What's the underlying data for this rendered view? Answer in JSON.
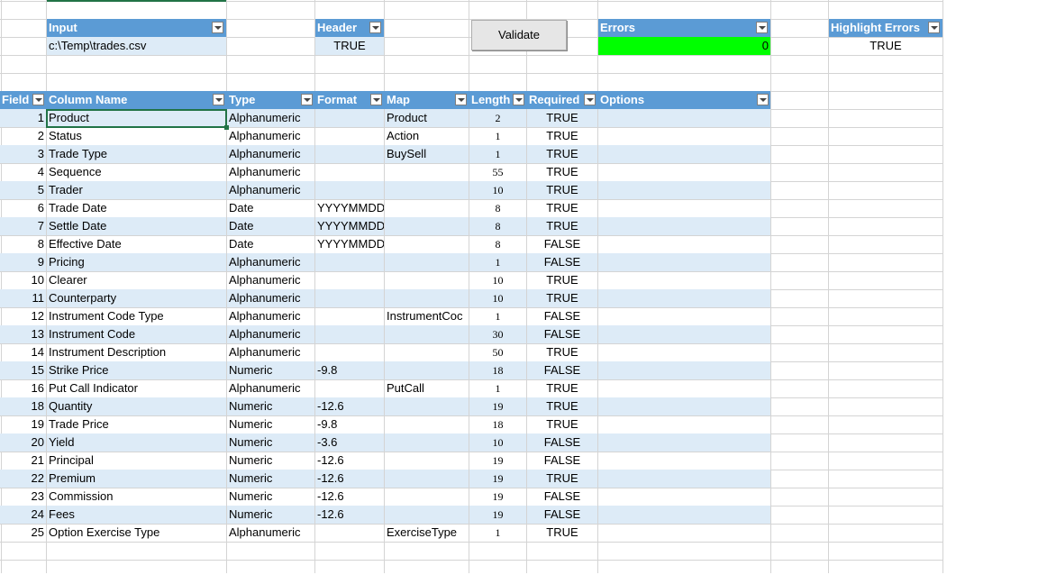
{
  "params": {
    "input": {
      "header": "Input",
      "value": "c:\\Temp\\trades.csv"
    },
    "header": {
      "header": "Header",
      "value": "TRUE"
    },
    "validate_label": "Validate",
    "errors": {
      "header": "Errors",
      "value": "0",
      "status_color": "#00ff00"
    },
    "highlight_errors": {
      "header": "Highlight Errors",
      "value": "TRUE"
    }
  },
  "table": {
    "columns": [
      "Field",
      "Column Name",
      "Type",
      "Format",
      "Map",
      "Length",
      "Required",
      "Options"
    ],
    "rows": [
      {
        "field": "1",
        "name": "Product",
        "type": "Alphanumeric",
        "format": "",
        "map": "Product",
        "length": "2",
        "required": "TRUE",
        "options": ""
      },
      {
        "field": "2",
        "name": "Status",
        "type": "Alphanumeric",
        "format": "",
        "map": "Action",
        "length": "1",
        "required": "TRUE",
        "options": ""
      },
      {
        "field": "3",
        "name": "Trade Type",
        "type": "Alphanumeric",
        "format": "",
        "map": "BuySell",
        "length": "1",
        "required": "TRUE",
        "options": ""
      },
      {
        "field": "4",
        "name": "Sequence",
        "type": "Alphanumeric",
        "format": "",
        "map": "",
        "length": "55",
        "required": "TRUE",
        "options": ""
      },
      {
        "field": "5",
        "name": "Trader",
        "type": "Alphanumeric",
        "format": "",
        "map": "",
        "length": "10",
        "required": "TRUE",
        "options": ""
      },
      {
        "field": "6",
        "name": "Trade Date",
        "type": "Date",
        "format": "YYYYMMDD",
        "map": "",
        "length": "8",
        "required": "TRUE",
        "options": ""
      },
      {
        "field": "7",
        "name": "Settle Date",
        "type": "Date",
        "format": "YYYYMMDD",
        "map": "",
        "length": "8",
        "required": "TRUE",
        "options": ""
      },
      {
        "field": "8",
        "name": "Effective Date",
        "type": "Date",
        "format": "YYYYMMDD",
        "map": "",
        "length": "8",
        "required": "FALSE",
        "options": ""
      },
      {
        "field": "9",
        "name": "Pricing",
        "type": "Alphanumeric",
        "format": "",
        "map": "",
        "length": "1",
        "required": "FALSE",
        "options": ""
      },
      {
        "field": "10",
        "name": "Clearer",
        "type": "Alphanumeric",
        "format": "",
        "map": "",
        "length": "10",
        "required": "TRUE",
        "options": ""
      },
      {
        "field": "11",
        "name": "Counterparty",
        "type": "Alphanumeric",
        "format": "",
        "map": "",
        "length": "10",
        "required": "TRUE",
        "options": ""
      },
      {
        "field": "12",
        "name": "Instrument Code Type",
        "type": "Alphanumeric",
        "format": "",
        "map": "InstrumentCoc",
        "length": "1",
        "required": "FALSE",
        "options": ""
      },
      {
        "field": "13",
        "name": "Instrument Code",
        "type": "Alphanumeric",
        "format": "",
        "map": "",
        "length": "30",
        "required": "FALSE",
        "options": ""
      },
      {
        "field": "14",
        "name": "Instrument Description",
        "type": "Alphanumeric",
        "format": "",
        "map": "",
        "length": "50",
        "required": "TRUE",
        "options": ""
      },
      {
        "field": "15",
        "name": "Strike Price",
        "type": "Numeric",
        "format": "-9.8",
        "map": "",
        "length": "18",
        "required": "FALSE",
        "options": ""
      },
      {
        "field": "16",
        "name": "Put Call Indicator",
        "type": "Alphanumeric",
        "format": "",
        "map": "PutCall",
        "length": "1",
        "required": "TRUE",
        "options": ""
      },
      {
        "field": "18",
        "name": "Quantity",
        "type": "Numeric",
        "format": "-12.6",
        "map": "",
        "length": "19",
        "required": "TRUE",
        "options": ""
      },
      {
        "field": "19",
        "name": "Trade Price",
        "type": "Numeric",
        "format": "-9.8",
        "map": "",
        "length": "18",
        "required": "TRUE",
        "options": ""
      },
      {
        "field": "20",
        "name": "Yield",
        "type": "Numeric",
        "format": "-3.6",
        "map": "",
        "length": "10",
        "required": "FALSE",
        "options": ""
      },
      {
        "field": "21",
        "name": "Principal",
        "type": "Numeric",
        "format": "-12.6",
        "map": "",
        "length": "19",
        "required": "FALSE",
        "options": ""
      },
      {
        "field": "22",
        "name": "Premium",
        "type": "Numeric",
        "format": "-12.6",
        "map": "",
        "length": "19",
        "required": "TRUE",
        "options": ""
      },
      {
        "field": "23",
        "name": "Commission",
        "type": "Numeric",
        "format": "-12.6",
        "map": "",
        "length": "19",
        "required": "FALSE",
        "options": ""
      },
      {
        "field": "24",
        "name": "Fees",
        "type": "Numeric",
        "format": "-12.6",
        "map": "",
        "length": "19",
        "required": "FALSE",
        "options": ""
      },
      {
        "field": "25",
        "name": "Option Exercise Type",
        "type": "Alphanumeric",
        "format": "",
        "map": "ExerciseType",
        "length": "1",
        "required": "TRUE",
        "options": ""
      }
    ]
  },
  "colors": {
    "table_header": "#5b9bd5",
    "band": "#ddebf7",
    "grid": "#d4d4d4"
  }
}
